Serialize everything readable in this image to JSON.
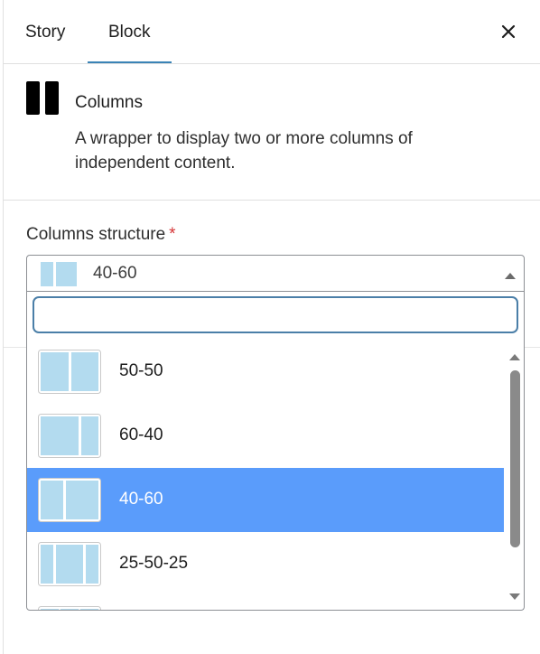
{
  "tabs": [
    {
      "label": "Story"
    },
    {
      "label": "Block"
    }
  ],
  "header": {
    "close_icon": "close-icon",
    "active_tab": "Block"
  },
  "block": {
    "name": "Columns",
    "description": "A wrapper to display two or more columns of independent content.",
    "icon": "columns-icon"
  },
  "field": {
    "label": "Columns structure",
    "required_mark": "*",
    "selected_value": "40-60"
  },
  "search": {
    "value": "",
    "placeholder": ""
  },
  "options": [
    {
      "label": "50-50",
      "selected": false
    },
    {
      "label": "60-40",
      "selected": false
    },
    {
      "label": "40-60",
      "selected": true
    },
    {
      "label": "25-50-25",
      "selected": false
    }
  ],
  "colors": {
    "accent": "#3a83b6",
    "selected_bg": "#5a9cfb",
    "thumb_fill": "#b3dbef",
    "required": "#d63638"
  }
}
